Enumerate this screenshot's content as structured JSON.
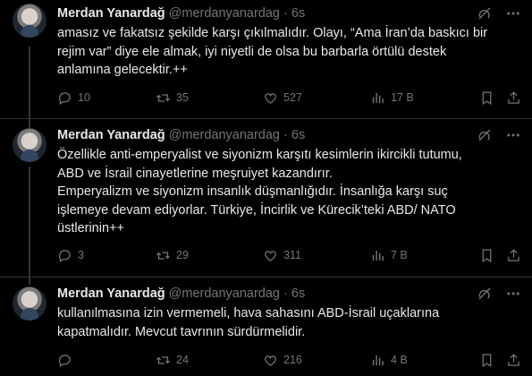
{
  "tweets": [
    {
      "name": "Merdan Yanardağ",
      "handle": "@merdanyanardag",
      "separator": "·",
      "time": "6s",
      "lines": [
        "amasız ve fakatsız şekilde karşı çıkılmalıdır. Olayı, “Ama İran’da baskıcı bir",
        "rejim var” diye ele almak, iyi niyetli de olsa bu barbarla örtülü destek",
        "anlamına gelecektir.++"
      ],
      "replies": "10",
      "reposts": "35",
      "likes": "527",
      "views": "17 B"
    },
    {
      "name": "Merdan Yanardağ",
      "handle": "@merdanyanardag",
      "separator": "·",
      "time": "6s",
      "lines": [
        "Özellikle anti-emperyalist ve siyonizm karşıtı kesimlerin ikircikli tutumu,",
        "ABD ve İsrail cinayetlerine meşruiyet kazandırır.",
        "Emperyalizm ve siyonizm insanlık düşmanlığıdır. İnsanlığa karşı suç",
        "işlemeye devam ediyorlar. Türkiye, İncirlik ve Kürecik’teki ABD/ NATO",
        "üstlerinin++"
      ],
      "replies": "3",
      "reposts": "29",
      "likes": "311",
      "views": "7 B"
    },
    {
      "name": "Merdan Yanardağ",
      "handle": "@merdanyanardag",
      "separator": "·",
      "time": "6s",
      "lines": [
        "kullanılmasına izin vermemeli, hava sahasını ABD-İsrail uçaklarına",
        "kapatmalıdır. Mevcut tavrının sürdürmelidir."
      ],
      "replies": "",
      "reposts": "24",
      "likes": "216",
      "views": "4 B"
    }
  ],
  "icons": {
    "reply": "reply-icon",
    "repost": "repost-icon",
    "like": "heart-icon",
    "views": "views-icon",
    "bookmark": "bookmark-icon",
    "share": "share-icon",
    "grok": "grok-icon",
    "more": "more-icon"
  }
}
